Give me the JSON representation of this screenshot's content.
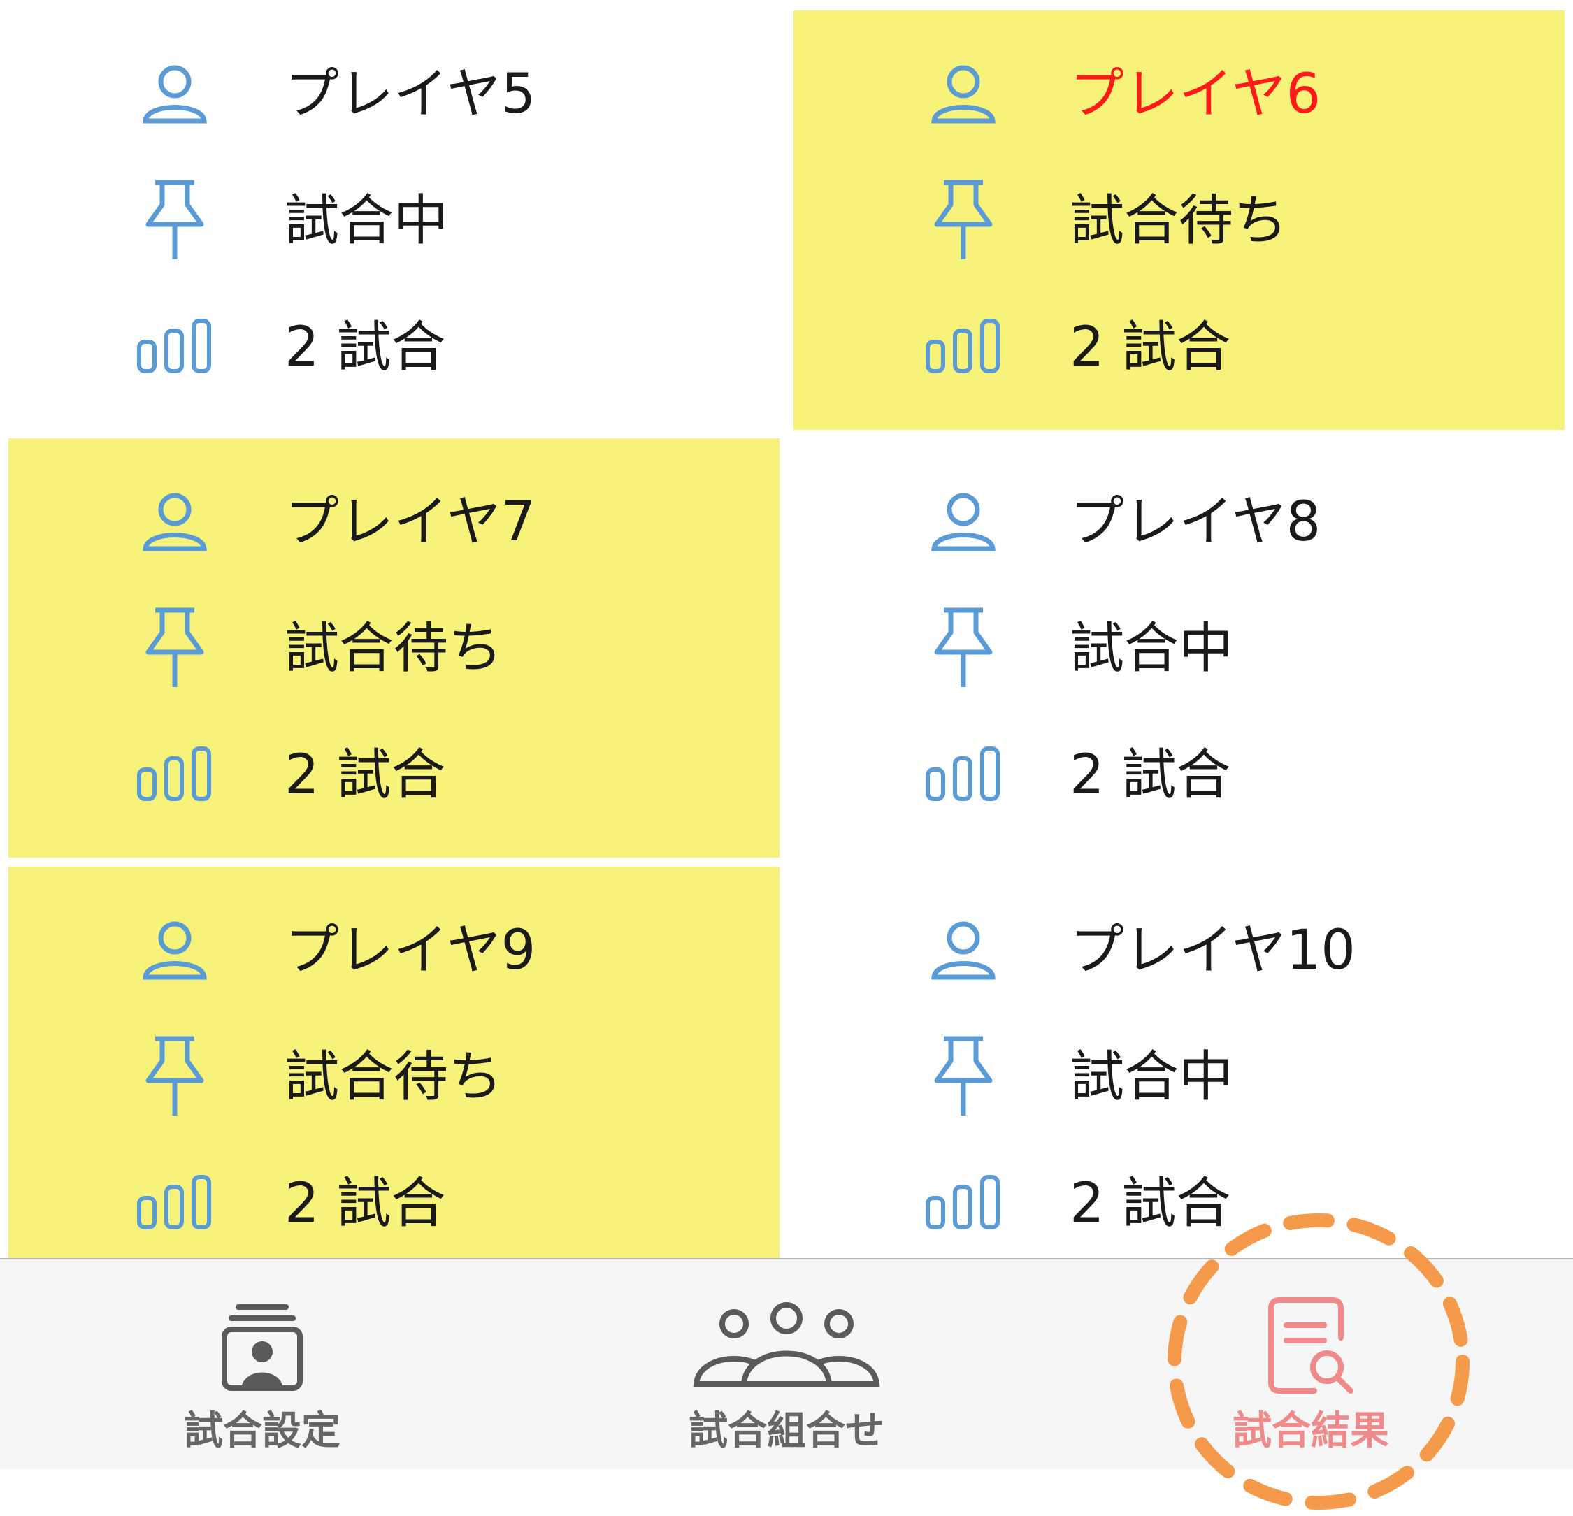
{
  "colors": {
    "highlight_bg": "#f7f27a",
    "icon_blue": "#5b9bd5",
    "text": "#1a1a1a",
    "name_alert": "#ff1a1a",
    "tab_inactive": "#666666",
    "tab_active": "#f08a8a",
    "annotation_ring": "#f59a4a"
  },
  "players": [
    {
      "name": "プレイヤ5",
      "status": "試合中",
      "matches": "2 試合",
      "highlighted": false,
      "name_alert": false
    },
    {
      "name": "プレイヤ6",
      "status": "試合待ち",
      "matches": "2 試合",
      "highlighted": true,
      "name_alert": true
    },
    {
      "name": "プレイヤ7",
      "status": "試合待ち",
      "matches": "2 試合",
      "highlighted": true,
      "name_alert": false
    },
    {
      "name": "プレイヤ8",
      "status": "試合中",
      "matches": "2 試合",
      "highlighted": false,
      "name_alert": false
    },
    {
      "name": "プレイヤ9",
      "status": "試合待ち",
      "matches": "2 試合",
      "highlighted": true,
      "name_alert": false
    },
    {
      "name": "プレイヤ10",
      "status": "試合中",
      "matches": "2 試合",
      "highlighted": false,
      "name_alert": false
    }
  ],
  "row_icons": [
    "person-icon",
    "pin-icon",
    "bar-chart-icon"
  ],
  "tabs": [
    {
      "label": "試合設定",
      "icon": "match-settings-icon",
      "active": false
    },
    {
      "label": "試合組合せ",
      "icon": "group-icon",
      "active": false
    },
    {
      "label": "試合結果",
      "icon": "results-document-search-icon",
      "active": true
    }
  ]
}
